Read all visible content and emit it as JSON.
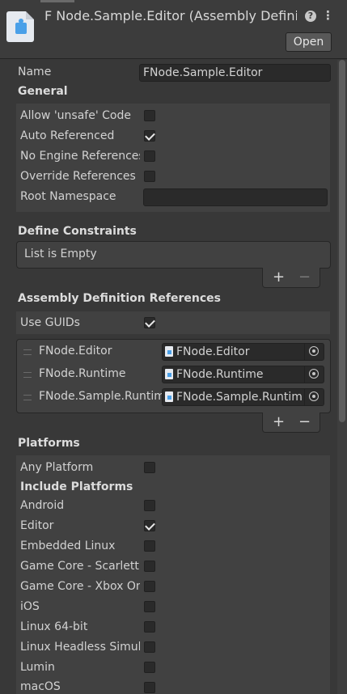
{
  "header": {
    "title": "F Node.Sample.Editor (Assembly Definit",
    "open_label": "Open",
    "help_glyph": "?",
    "menu_glyph": "⋮"
  },
  "name_field": {
    "label": "Name",
    "value": "FNode.Sample.Editor"
  },
  "general": {
    "heading": "General",
    "rows": [
      {
        "label": "Allow 'unsafe' Code",
        "checked": false
      },
      {
        "label": "Auto Referenced",
        "checked": true
      },
      {
        "label": "No Engine References",
        "checked": false
      },
      {
        "label": "Override References",
        "checked": false
      }
    ],
    "root_namespace": {
      "label": "Root Namespace",
      "value": ""
    }
  },
  "define_constraints": {
    "heading": "Define Constraints",
    "empty_label": "List is Empty",
    "add_glyph": "+",
    "remove_glyph": "−"
  },
  "assembly_refs": {
    "heading": "Assembly Definition References",
    "use_guids": {
      "label": "Use GUIDs",
      "checked": true
    },
    "items": [
      {
        "label": "FNode.Editor",
        "value": "FNode.Editor"
      },
      {
        "label": "FNode.Runtime",
        "value": "FNode.Runtime"
      },
      {
        "label": "FNode.Sample.Runtime",
        "value": "FNode.Sample.Runtime"
      }
    ],
    "add_glyph": "+",
    "remove_glyph": "−"
  },
  "platforms": {
    "heading": "Platforms",
    "any_platform": {
      "label": "Any Platform",
      "checked": false
    },
    "include_heading": "Include Platforms",
    "items": [
      {
        "label": "Android",
        "checked": false
      },
      {
        "label": "Editor",
        "checked": true
      },
      {
        "label": "Embedded Linux",
        "checked": false
      },
      {
        "label": "Game Core - Scarlett",
        "checked": false
      },
      {
        "label": "Game Core - Xbox One",
        "checked": false
      },
      {
        "label": "iOS",
        "checked": false
      },
      {
        "label": "Linux 64-bit",
        "checked": false
      },
      {
        "label": "Linux Headless Simulation",
        "checked": false
      },
      {
        "label": "Lumin",
        "checked": false
      },
      {
        "label": "macOS",
        "checked": false
      }
    ]
  }
}
